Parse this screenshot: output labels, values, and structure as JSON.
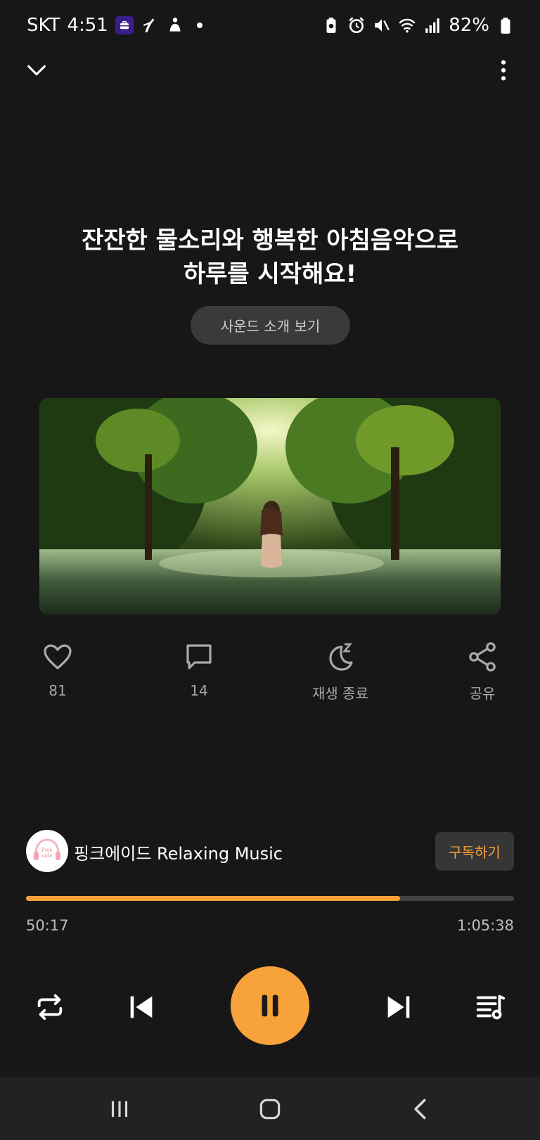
{
  "status_bar": {
    "carrier": "SKT",
    "time": "4:51",
    "battery": "82%",
    "left_icons": [
      "briefcase-app-icon",
      "wave-app-icon",
      "person-app-icon"
    ],
    "right_icons": [
      "battery-saver-icon",
      "alarm-icon",
      "mute-icon",
      "wifi-icon",
      "signal-icon",
      "battery-icon"
    ]
  },
  "header": {
    "title": "잔잔한 물소리와 행복한 아침음악으로\n하루를 시작해요!",
    "intro_button": "사운드 소개 보기"
  },
  "actions": [
    {
      "icon": "heart-icon",
      "label": "81"
    },
    {
      "icon": "comment-icon",
      "label": "14"
    },
    {
      "icon": "sleep-timer-icon",
      "label": "재생 종료"
    },
    {
      "icon": "share-icon",
      "label": "공유"
    }
  ],
  "channel": {
    "name": "핑크에이드 Relaxing Music",
    "subscribe_label": "구독하기",
    "avatar_text": "Pink aide"
  },
  "player": {
    "elapsed": "50:17",
    "duration": "1:05:38",
    "progress_fraction": 0.767
  },
  "colors": {
    "accent": "#f7a23a",
    "background": "#171717",
    "nav_bar": "#222222"
  }
}
